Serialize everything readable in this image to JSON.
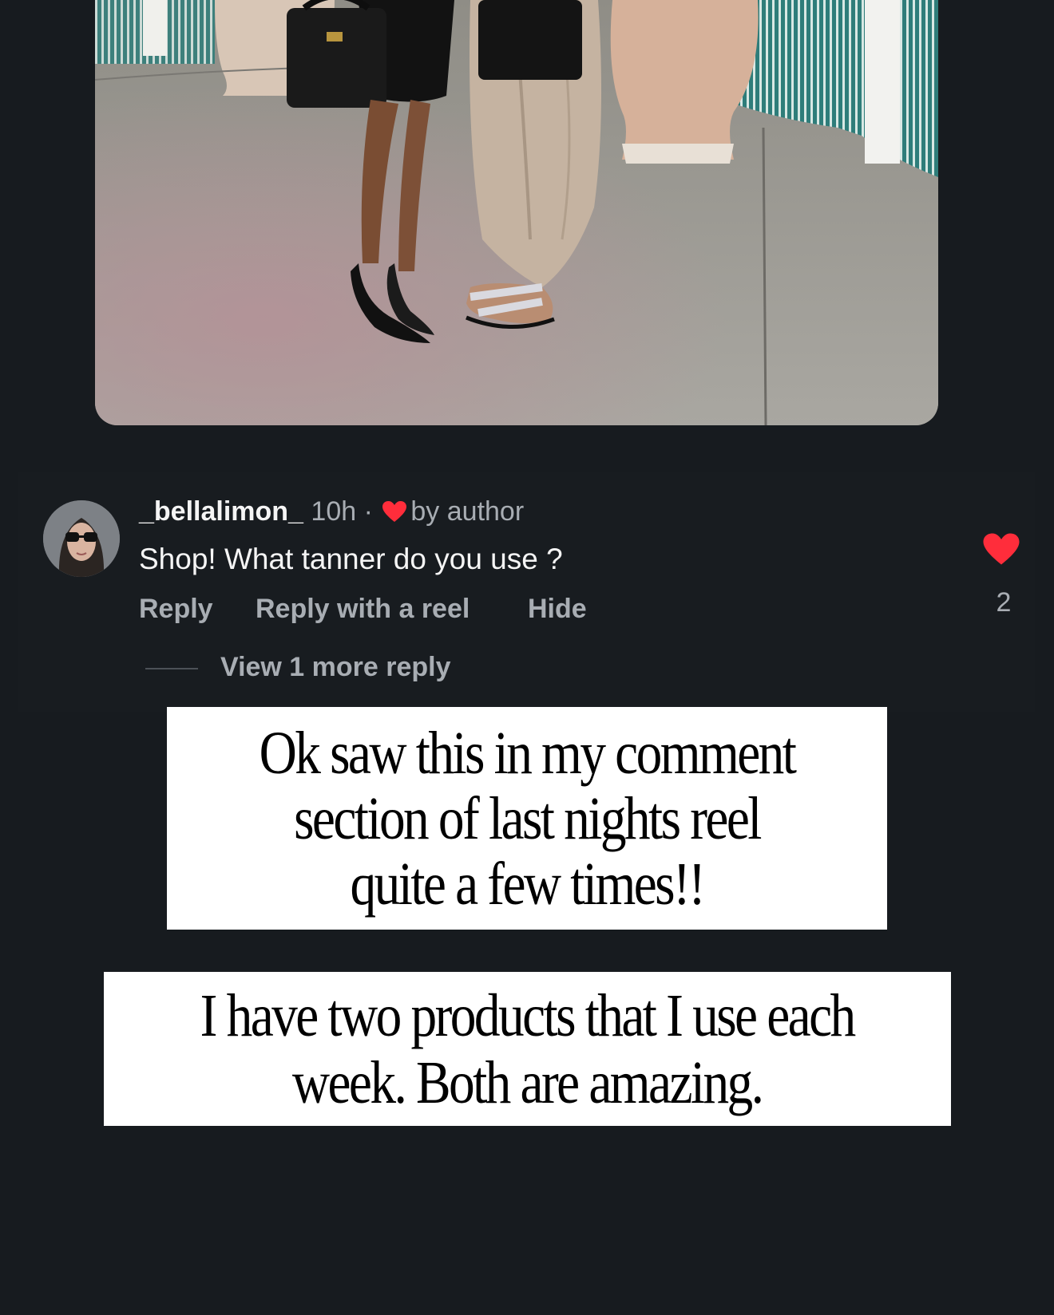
{
  "comment": {
    "username": "_bellalimon_",
    "time": "10h",
    "separator": "·",
    "liked_by": "by author",
    "text": "Shop! What tanner do you use ?",
    "actions": {
      "reply": "Reply",
      "reply_reel": "Reply with a reel",
      "hide": "Hide"
    },
    "view_more": "View 1 more reply",
    "like_count": "2"
  },
  "captions": {
    "first": [
      "Ok saw this in my comment",
      "section of last nights reel",
      "quite a few times!!"
    ],
    "second": [
      "I have two products that I use each",
      "week. Both are amazing."
    ]
  },
  "colors": {
    "background": "#171b1f",
    "heart": "#ff2d3b",
    "muted_text": "#a8adb3"
  }
}
